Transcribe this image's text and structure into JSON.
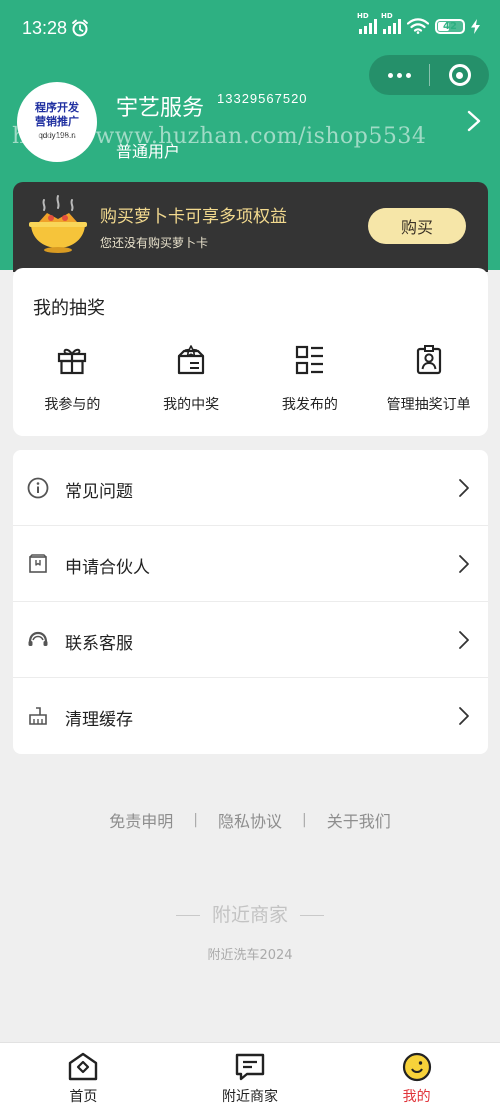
{
  "status_bar": {
    "time": "13:28",
    "battery": "42",
    "battery_level": 0.42
  },
  "profile": {
    "avatar_lines": [
      "程序开发",
      "营销推广",
      "qddy198.n"
    ],
    "name": "宇艺服务",
    "phone": "13329567520",
    "role": "普通用户",
    "watermark": "https://www.huzhan.com/ishop5534"
  },
  "vip": {
    "title": "购买萝卜卡可享多项权益",
    "subtitle": "您还没有购买萝卜卡",
    "buy_label": "购买"
  },
  "lottery": {
    "title": "我的抽奖",
    "items": [
      {
        "label": "我参与的",
        "icon": "gift-icon"
      },
      {
        "label": "我的中奖",
        "icon": "prize-box-icon"
      },
      {
        "label": "我发布的",
        "icon": "list-grid-icon"
      },
      {
        "label": "管理抽奖订单",
        "icon": "badge-icon"
      }
    ]
  },
  "menu": [
    {
      "label": "常见问题",
      "icon": "info-icon"
    },
    {
      "label": "申请合伙人",
      "icon": "partner-box-icon"
    },
    {
      "label": "联系客服",
      "icon": "headset-icon"
    },
    {
      "label": "清理缓存",
      "icon": "broom-icon"
    }
  ],
  "footer": {
    "links": [
      "免责申明",
      "隐私协议",
      "关于我们"
    ],
    "separator": "|",
    "brand": "附近商家",
    "sub": "附近洗车2024"
  },
  "tabbar": {
    "tabs": [
      {
        "label": "首页",
        "icon": "home-icon",
        "active": false
      },
      {
        "label": "附近商家",
        "icon": "message-icon",
        "active": false
      },
      {
        "label": "我的",
        "icon": "profile-face-icon",
        "active": true
      }
    ]
  },
  "colors": {
    "brand_green": "#2eb082",
    "vip_bg": "#343434",
    "vip_gold": "#f2d98e",
    "buy_button": "#f6e6a8",
    "active_tab": "#e0343a"
  }
}
